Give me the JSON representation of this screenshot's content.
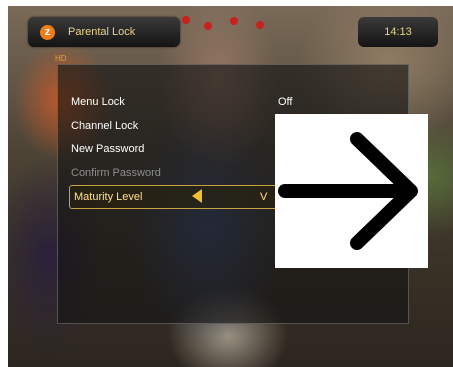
{
  "header": {
    "logo_glyph": "z",
    "logo_text": "HD",
    "title": "Parental Lock",
    "time": "14:13"
  },
  "menu": {
    "items": [
      {
        "label": "Menu Lock",
        "value": "Off"
      },
      {
        "label": "Channel Lock",
        "value": ""
      },
      {
        "label": "New Password",
        "value": ""
      },
      {
        "label": "Confirm Password",
        "value": ""
      },
      {
        "label": "Maturity Level",
        "value": "V"
      }
    ]
  },
  "overlay": {
    "icon": "right-arrow-icon"
  },
  "colors": {
    "accent": "#c8a341",
    "header_text": "#e6d38a",
    "logo": "#ef7d1a",
    "disabled_text": "#8d8d8d"
  }
}
